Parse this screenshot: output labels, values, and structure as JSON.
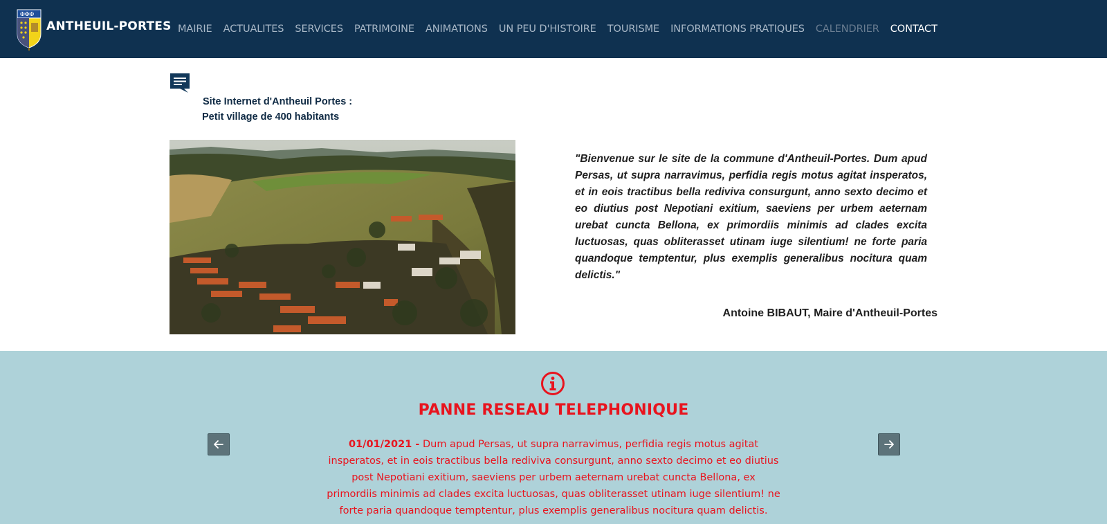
{
  "site": {
    "name": "ANTHEUIL-PORTES"
  },
  "nav": {
    "items": [
      {
        "label": "MAIRIE"
      },
      {
        "label": "ACTUALITES"
      },
      {
        "label": "SERVICES"
      },
      {
        "label": "PATRIMOINE"
      },
      {
        "label": "ANIMATIONS"
      },
      {
        "label": "UN PEU D'HISTOIRE"
      },
      {
        "label": "TOURISME"
      },
      {
        "label": "INFORMATIONS PRATIQUES"
      },
      {
        "label": "CALENDRIER"
      },
      {
        "label": "CONTACT"
      }
    ]
  },
  "intro": {
    "line1": "Site Internet d'Antheuil Portes :",
    "line2": "Petit village de 400 habitants"
  },
  "welcome": {
    "quote": "\"Bienvenue sur le site de la commune d'Antheuil-Portes. Dum apud Persas, ut supra narravimus, perfidia regis motus agitat insperatos, et in eois tractibus bella rediviva consurgunt, anno sexto decimo et eo diutius post Nepotiani exitium, saeviens per urbem aeternam urebat cuncta Bellona, ex primordiis minimis ad clades excita luctuosas, quas obliterasset utinam iuge silentium! ne forte paria quandoque temptentur, plus exemplis generalibus nocitura quam delictis.\"",
    "signature": "Antoine BIBAUT, Maire d'Antheuil-Portes"
  },
  "alert": {
    "title": "PANNE RESEAU TELEPHONIQUE",
    "date": "01/01/2021 -",
    "text": " Dum apud Persas, ut supra narravimus, perfidia regis motus agitat insperatos, et in eois tractibus bella rediviva consurgunt, anno sexto decimo et eo diutius post Nepotiani exitium, saeviens per urbem aeternam urebat cuncta Bellona, ex primordiis minimis ad clades excita luctuosas, quas obliterasset utinam iuge silentium! ne forte paria quandoque temptentur, plus exemplis generalibus nocitura quam delictis."
  },
  "colors": {
    "navbar": "#0f3150",
    "nav_link": "#a9b8c7",
    "nav_link_active": "#ffffff",
    "alert_band": "#aed2d9",
    "alert_red": "#e8141e",
    "arrow_button": "#5d737a"
  },
  "icons": {
    "crest": "coat-of-arms-icon",
    "intro": "chat-bubble-icon",
    "alert": "info-circle-icon",
    "prev": "arrow-left-icon",
    "next": "arrow-right-icon"
  }
}
